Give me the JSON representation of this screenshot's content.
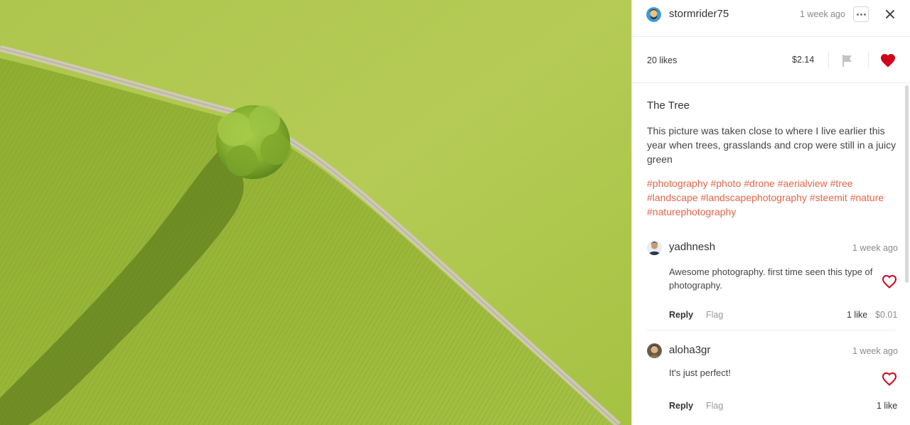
{
  "post": {
    "author": "stormrider75",
    "time": "1 week ago",
    "likes": "20 likes",
    "payout": "$2.14",
    "title": "The Tree",
    "body": "This picture was taken close to where I live earlier this year when trees, grasslands and crop were still in a juicy green",
    "tags": [
      "#photography",
      "#photo",
      "#drone",
      "#aerialview",
      "#tree",
      "#landscape",
      "#landscapephotography",
      "#steemit",
      "#nature",
      "#naturephotography"
    ]
  },
  "icons": {
    "more": "more-options-icon",
    "close": "close-icon",
    "flag": "flag-icon",
    "heart": "heart-icon"
  },
  "colors": {
    "accent_red": "#d0021b",
    "tag_orange": "#e0664a",
    "field_green": "#9cb93a"
  },
  "comments": [
    {
      "author": "yadhnesh",
      "time": "1 week ago",
      "text": "Awesome photography. first time seen this type of photography.",
      "reply_label": "Reply",
      "flag_label": "Flag",
      "likes": "1 like",
      "payout": "$0.01"
    },
    {
      "author": "aloha3gr",
      "time": "1 week ago",
      "text": "It's just perfect!",
      "reply_label": "Reply",
      "flag_label": "Flag",
      "likes": "1 like",
      "payout": ""
    }
  ]
}
